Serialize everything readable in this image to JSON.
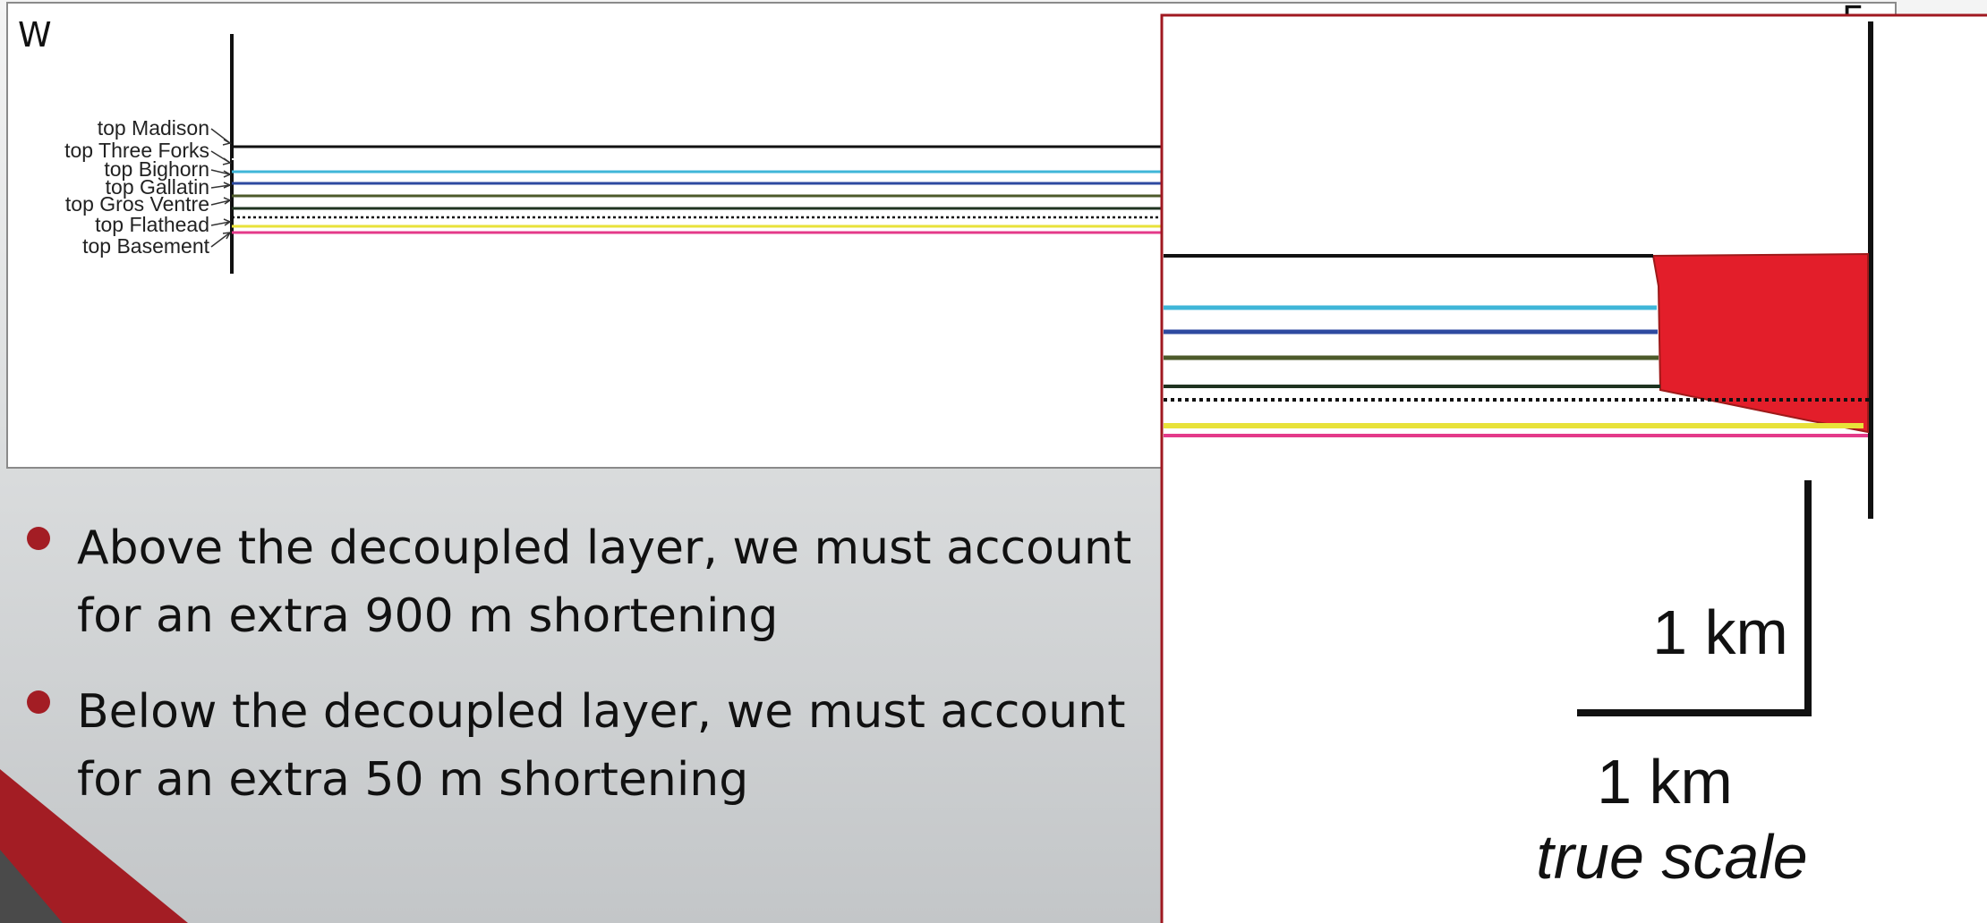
{
  "cross_section": {
    "west_label": "W",
    "east_label": "E",
    "horizons": [
      {
        "label": "top Madison",
        "color": "#111111",
        "style": "solid"
      },
      {
        "label": "top Three Forks",
        "color": "#111111",
        "style": "solid"
      },
      {
        "label": "top Bighorn",
        "color": "#3fb6d8",
        "style": "solid"
      },
      {
        "label": "top Gallatin",
        "color": "#2e4aa0",
        "style": "solid"
      },
      {
        "label": "top Gros Ventre",
        "color": "#4d5a2a",
        "style": "solid"
      },
      {
        "label": "top Flathead",
        "color": "#111111",
        "style": "dotted"
      },
      {
        "label": "top Basement",
        "color": "#e43a8a",
        "style": "solid"
      }
    ],
    "flathead_color": "#e8e23a",
    "wedge_color": "#e31e2a"
  },
  "bullets": [
    {
      "line1": "Above the decoupled layer, we must account",
      "line2": "for an extra 900 m shortening"
    },
    {
      "line1": "Below the decoupled layer, we must account",
      "line2": "for an extra 50 m shortening"
    }
  ],
  "detail": {
    "scale_vertical_label": "1 km",
    "scale_horizontal_label": "1 km",
    "scale_caption": "true scale",
    "border_color": "#a01820"
  },
  "theme": {
    "accent": "#a31d24",
    "bullet_color": "#a31d24"
  }
}
